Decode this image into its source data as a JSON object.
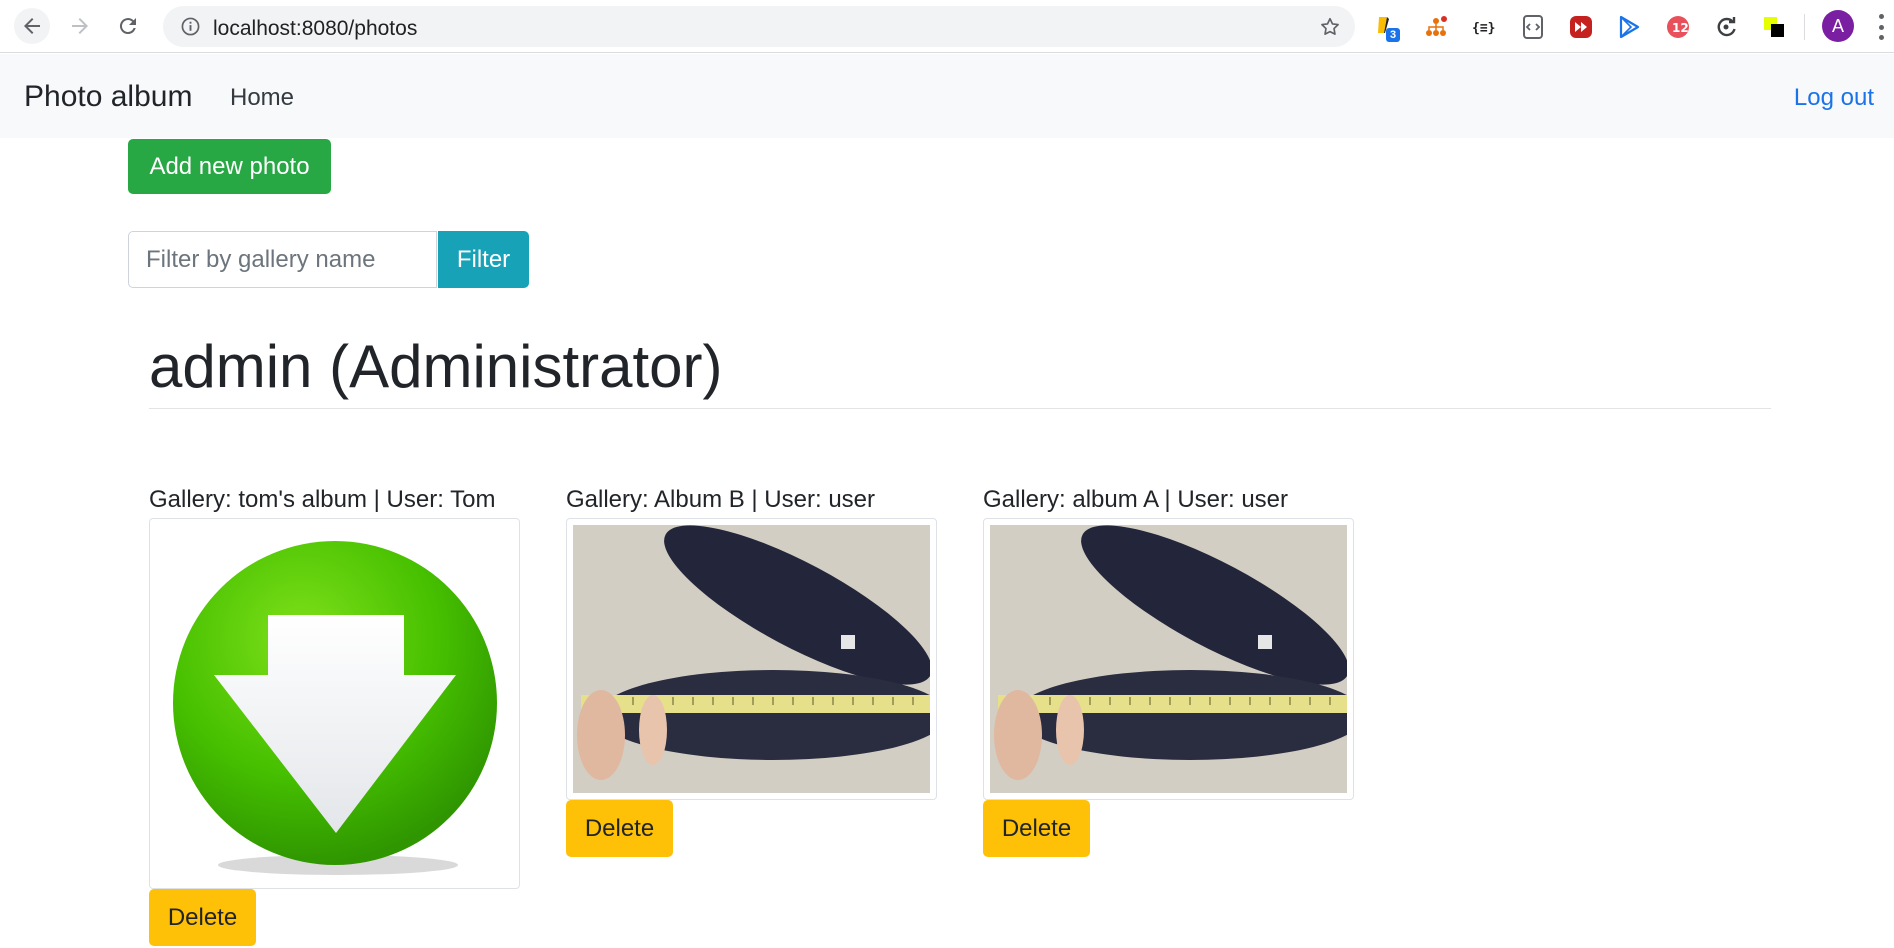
{
  "browser": {
    "url": "localhost:8080/photos",
    "extension_badge": "3",
    "profile_initial": "A",
    "extensions": [
      "highlighter-extension-icon",
      "sitemap-extension-icon",
      "json-viewer-icon",
      "code-inspector-icon",
      "media-player-icon",
      "play-store-icon",
      "speed-tool-icon",
      "refresh-tool-icon",
      "color-picker-icon"
    ]
  },
  "navbar": {
    "brand": "Photo album",
    "home": "Home",
    "logout": "Log out"
  },
  "actions": {
    "add_photo": "Add new photo",
    "filter_placeholder": "Filter by gallery name",
    "filter_button": "Filter"
  },
  "user_heading": "admin (Administrator)",
  "photos": [
    {
      "label": "Gallery: tom's album | User: Tom",
      "image": "download-arrow-icon",
      "delete": "Delete"
    },
    {
      "label": "Gallery: Album B | User: user",
      "image": "shoe-insoles-with-measuring-tape-photo",
      "delete": "Delete"
    },
    {
      "label": "Gallery: album A | User: user",
      "image": "shoe-insoles-with-measuring-tape-photo",
      "delete": "Delete"
    }
  ],
  "colors": {
    "success": "#28a745",
    "info": "#17a2b8",
    "warning": "#ffc107",
    "link": "#1a73e8"
  }
}
